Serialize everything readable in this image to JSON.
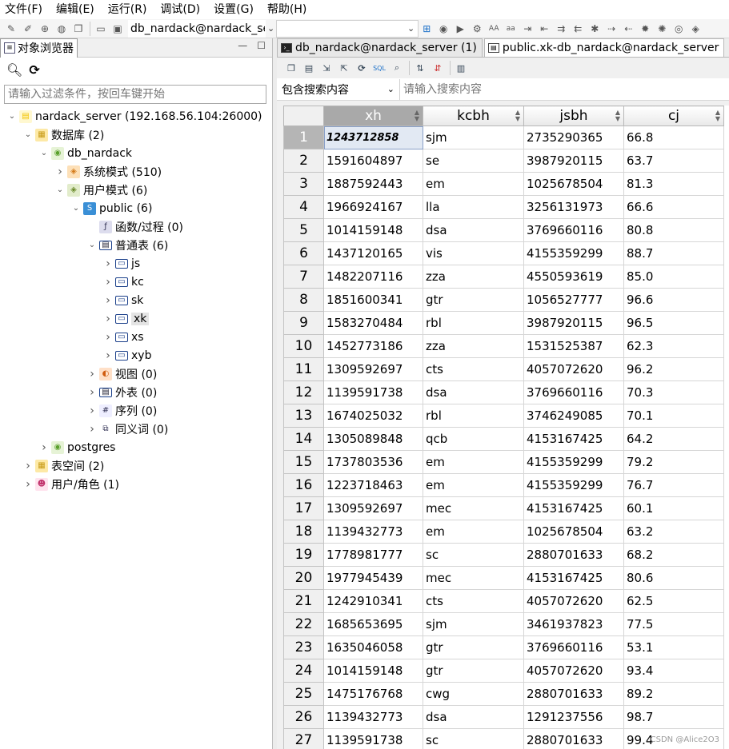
{
  "menubar": {
    "items": [
      "文件(F)",
      "编辑(E)",
      "运行(R)",
      "调试(D)",
      "设置(G)",
      "帮助(H)"
    ]
  },
  "toolbar": {
    "connection": "db_nardack@nardack_server",
    "database": ""
  },
  "left_panel": {
    "tab_label": "对象浏览器",
    "filter_placeholder": "请输入过滤条件，按回车键开始",
    "tree": [
      {
        "label": "nardack_server (192.168.56.104:26000)",
        "icon": "server-icon",
        "depth": 0,
        "expanded": true
      },
      {
        "label": "数据库 (2)",
        "icon": "database-folder-icon",
        "depth": 1,
        "expanded": true
      },
      {
        "label": "db_nardack",
        "icon": "database-icon",
        "depth": 2,
        "expanded": true
      },
      {
        "label": "系统模式 (510)",
        "icon": "system-schema-icon",
        "depth": 3,
        "expanded": false
      },
      {
        "label": "用户模式 (6)",
        "icon": "user-schema-icon",
        "depth": 3,
        "expanded": true
      },
      {
        "label": "public (6)",
        "icon": "schema-icon",
        "depth": 4,
        "expanded": true
      },
      {
        "label": "函数/过程 (0)",
        "icon": "function-icon",
        "depth": 5,
        "expanded": null
      },
      {
        "label": "普通表 (6)",
        "icon": "table-folder-icon",
        "depth": 5,
        "expanded": true
      },
      {
        "label": "js",
        "icon": "table-icon",
        "depth": 6,
        "expanded": false
      },
      {
        "label": "kc",
        "icon": "table-icon",
        "depth": 6,
        "expanded": false
      },
      {
        "label": "sk",
        "icon": "table-icon",
        "depth": 6,
        "expanded": false
      },
      {
        "label": "xk",
        "icon": "table-icon",
        "depth": 6,
        "expanded": false,
        "selected": true
      },
      {
        "label": "xs",
        "icon": "table-icon",
        "depth": 6,
        "expanded": false
      },
      {
        "label": "xyb",
        "icon": "table-icon",
        "depth": 6,
        "expanded": false
      },
      {
        "label": "视图 (0)",
        "icon": "view-icon",
        "depth": 5,
        "expanded": false
      },
      {
        "label": "外表 (0)",
        "icon": "foreign-table-icon",
        "depth": 5,
        "expanded": false
      },
      {
        "label": "序列 (0)",
        "icon": "sequence-icon",
        "depth": 5,
        "expanded": false
      },
      {
        "label": "同义词 (0)",
        "icon": "synonym-icon",
        "depth": 5,
        "expanded": false
      },
      {
        "label": "postgres",
        "icon": "database-icon",
        "depth": 2,
        "expanded": false
      },
      {
        "label": "表空间 (2)",
        "icon": "tablespace-icon",
        "depth": 1,
        "expanded": false
      },
      {
        "label": "用户/角色 (1)",
        "icon": "users-icon",
        "depth": 1,
        "expanded": false
      }
    ]
  },
  "right_panel": {
    "tabs": [
      {
        "label": "db_nardack@nardack_server (1)",
        "icon": "terminal-icon",
        "active": false
      },
      {
        "label": "public.xk-db_nardack@nardack_server",
        "icon": "table-tab-icon",
        "active": true
      }
    ],
    "search_mode": "包含搜索内容",
    "search_placeholder": "请输入搜索内容",
    "columns": [
      "xh",
      "kcbh",
      "jsbh",
      "cj"
    ],
    "rows": [
      [
        "1243712858",
        "sjm",
        "2735290365",
        "66.8"
      ],
      [
        "1591604897",
        "se",
        "3987920115",
        "63.7"
      ],
      [
        "1887592443",
        "em",
        "1025678504",
        "81.3"
      ],
      [
        "1966924167",
        "lla",
        "3256131973",
        "66.6"
      ],
      [
        "1014159148",
        "dsa",
        "3769660116",
        "80.8"
      ],
      [
        "1437120165",
        "vis",
        "4155359299",
        "88.7"
      ],
      [
        "1482207116",
        "zza",
        "4550593619",
        "85.0"
      ],
      [
        "1851600341",
        "gtr",
        "1056527777",
        "96.6"
      ],
      [
        "1583270484",
        "rbl",
        "3987920115",
        "96.5"
      ],
      [
        "1452773186",
        "zza",
        "1531525387",
        "62.3"
      ],
      [
        "1309592697",
        "cts",
        "4057072620",
        "96.2"
      ],
      [
        "1139591738",
        "dsa",
        "3769660116",
        "70.3"
      ],
      [
        "1674025032",
        "rbl",
        "3746249085",
        "70.1"
      ],
      [
        "1305089848",
        "qcb",
        "4153167425",
        "64.2"
      ],
      [
        "1737803536",
        "em",
        "4155359299",
        "79.2"
      ],
      [
        "1223718463",
        "em",
        "4155359299",
        "76.7"
      ],
      [
        "1309592697",
        "mec",
        "4153167425",
        "60.1"
      ],
      [
        "1139432773",
        "em",
        "1025678504",
        "63.2"
      ],
      [
        "1778981777",
        "sc",
        "2880701633",
        "68.2"
      ],
      [
        "1977945439",
        "mec",
        "4153167425",
        "80.6"
      ],
      [
        "1242910341",
        "cts",
        "4057072620",
        "62.5"
      ],
      [
        "1685653695",
        "sjm",
        "3461937823",
        "77.5"
      ],
      [
        "1635046058",
        "gtr",
        "3769660116",
        "53.1"
      ],
      [
        "1014159148",
        "gtr",
        "4057072620",
        "93.4"
      ],
      [
        "1475176768",
        "cwg",
        "2880701633",
        "89.2"
      ],
      [
        "1139432773",
        "dsa",
        "1291237556",
        "98.7"
      ],
      [
        "1139591738",
        "sc",
        "2880701633",
        "99.4"
      ]
    ]
  },
  "watermark": "CSDN @Alice2O3"
}
